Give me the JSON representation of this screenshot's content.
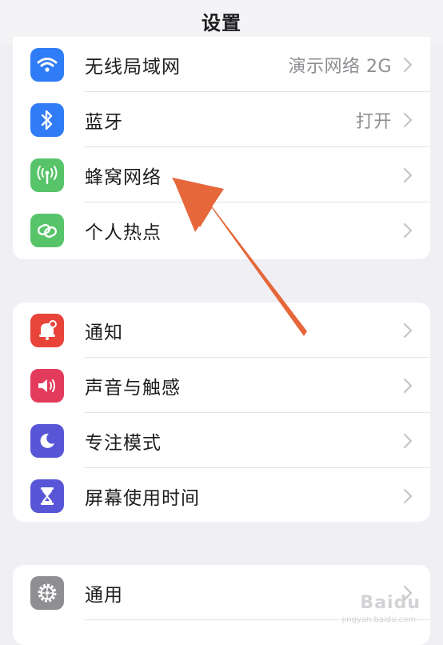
{
  "header": {
    "title": "设置"
  },
  "groups": [
    {
      "rows": [
        {
          "label": "无线局域网",
          "value": "演示网络 2G",
          "icon": "wifi-icon",
          "color": "#2f7cf6"
        },
        {
          "label": "蓝牙",
          "value": "打开",
          "icon": "bluetooth-icon",
          "color": "#2f7cf6"
        },
        {
          "label": "蜂窝网络",
          "value": "",
          "icon": "cellular-antenna-icon",
          "color": "#57c46a"
        },
        {
          "label": "个人热点",
          "value": "",
          "icon": "hotspot-link-icon",
          "color": "#57c46a"
        }
      ]
    },
    {
      "rows": [
        {
          "label": "通知",
          "value": "",
          "icon": "notification-bell-icon",
          "color": "#e8443a"
        },
        {
          "label": "声音与触感",
          "value": "",
          "icon": "speaker-icon",
          "color": "#e33b5c"
        },
        {
          "label": "专注模式",
          "value": "",
          "icon": "moon-icon",
          "color": "#5856d6"
        },
        {
          "label": "屏幕使用时间",
          "value": "",
          "icon": "hourglass-icon",
          "color": "#5856d6"
        }
      ]
    },
    {
      "rows": [
        {
          "label": "通用",
          "value": "",
          "icon": "gear-icon",
          "color": "#8e8e93"
        }
      ]
    }
  ],
  "annotation": {
    "arrow_color": "#e5673a"
  },
  "watermark": {
    "text": "Baidu",
    "sub": "jingyan.baidu.com"
  }
}
